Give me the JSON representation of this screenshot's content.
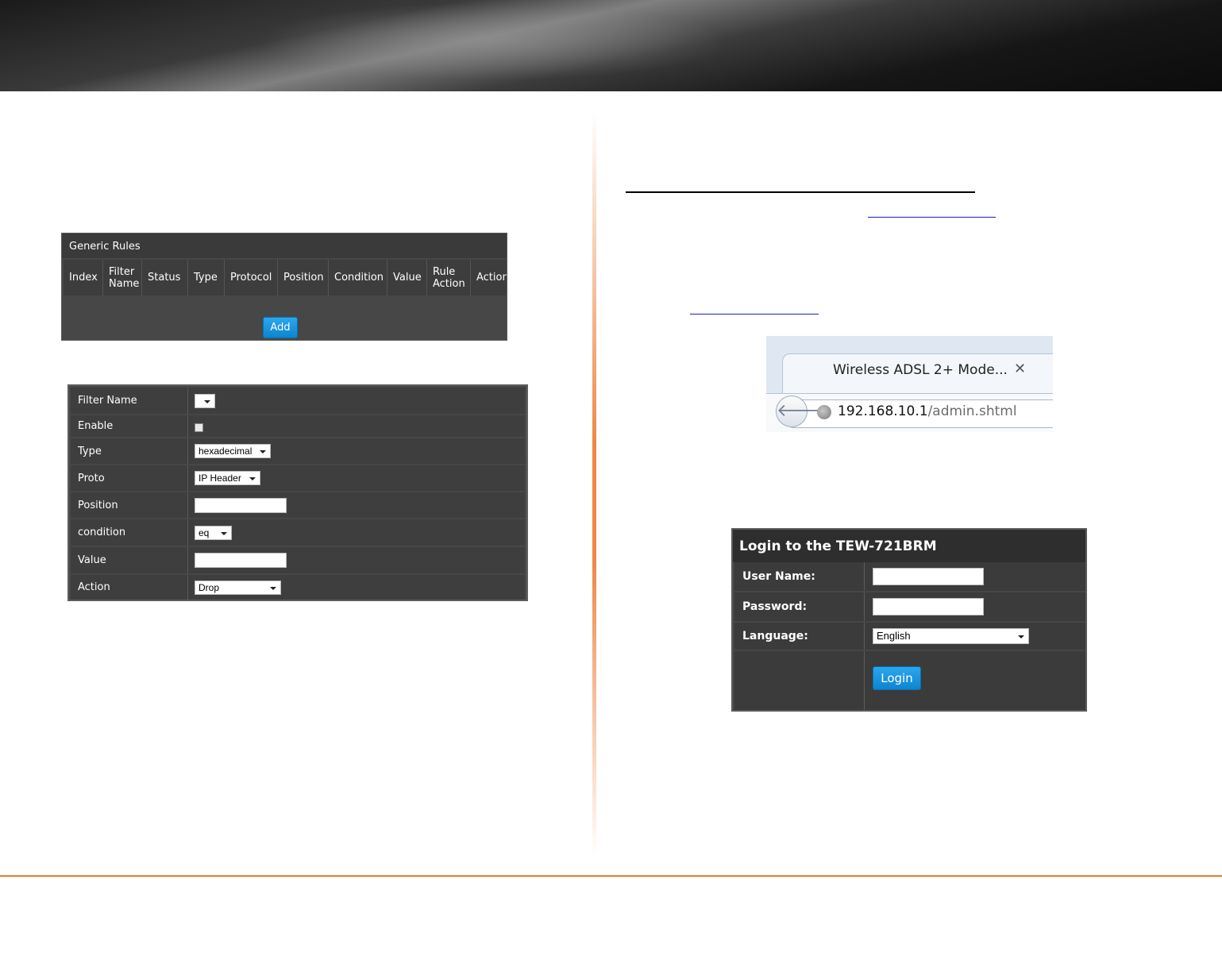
{
  "generic_rules": {
    "title": "Generic Rules",
    "columns": [
      "Index",
      "Filter\nName",
      "Status",
      "Type",
      "Protocol",
      "Position",
      "Condition",
      "Value",
      "Rule\nAction",
      "Action"
    ],
    "add_label": "Add"
  },
  "filter_form": {
    "rows": [
      {
        "label": "Filter Name",
        "value": ""
      },
      {
        "label": "Enable",
        "checked": false
      },
      {
        "label": "Type",
        "value": "hexadecimal"
      },
      {
        "label": "Proto",
        "value": "IP Header"
      },
      {
        "label": "Position",
        "value": ""
      },
      {
        "label": "condition",
        "value": "eq"
      },
      {
        "label": "Value",
        "value": ""
      },
      {
        "label": "Action",
        "value": "Drop"
      }
    ]
  },
  "browser": {
    "tab_title": "Wireless ADSL 2+ Mode...",
    "url_host": "192.168.10.1",
    "url_path": "/admin.shtml"
  },
  "login": {
    "title": "Login to the TEW-721BRM",
    "username_label": "User Name:",
    "password_label": "Password:",
    "language_label": "Language:",
    "language_value": "English",
    "login_label": "Login"
  },
  "colors": {
    "accent_orange": "#e87a36",
    "button_blue": "#1a96de",
    "panel_dark": "#474747",
    "link_blue": "#1a1ad6"
  }
}
